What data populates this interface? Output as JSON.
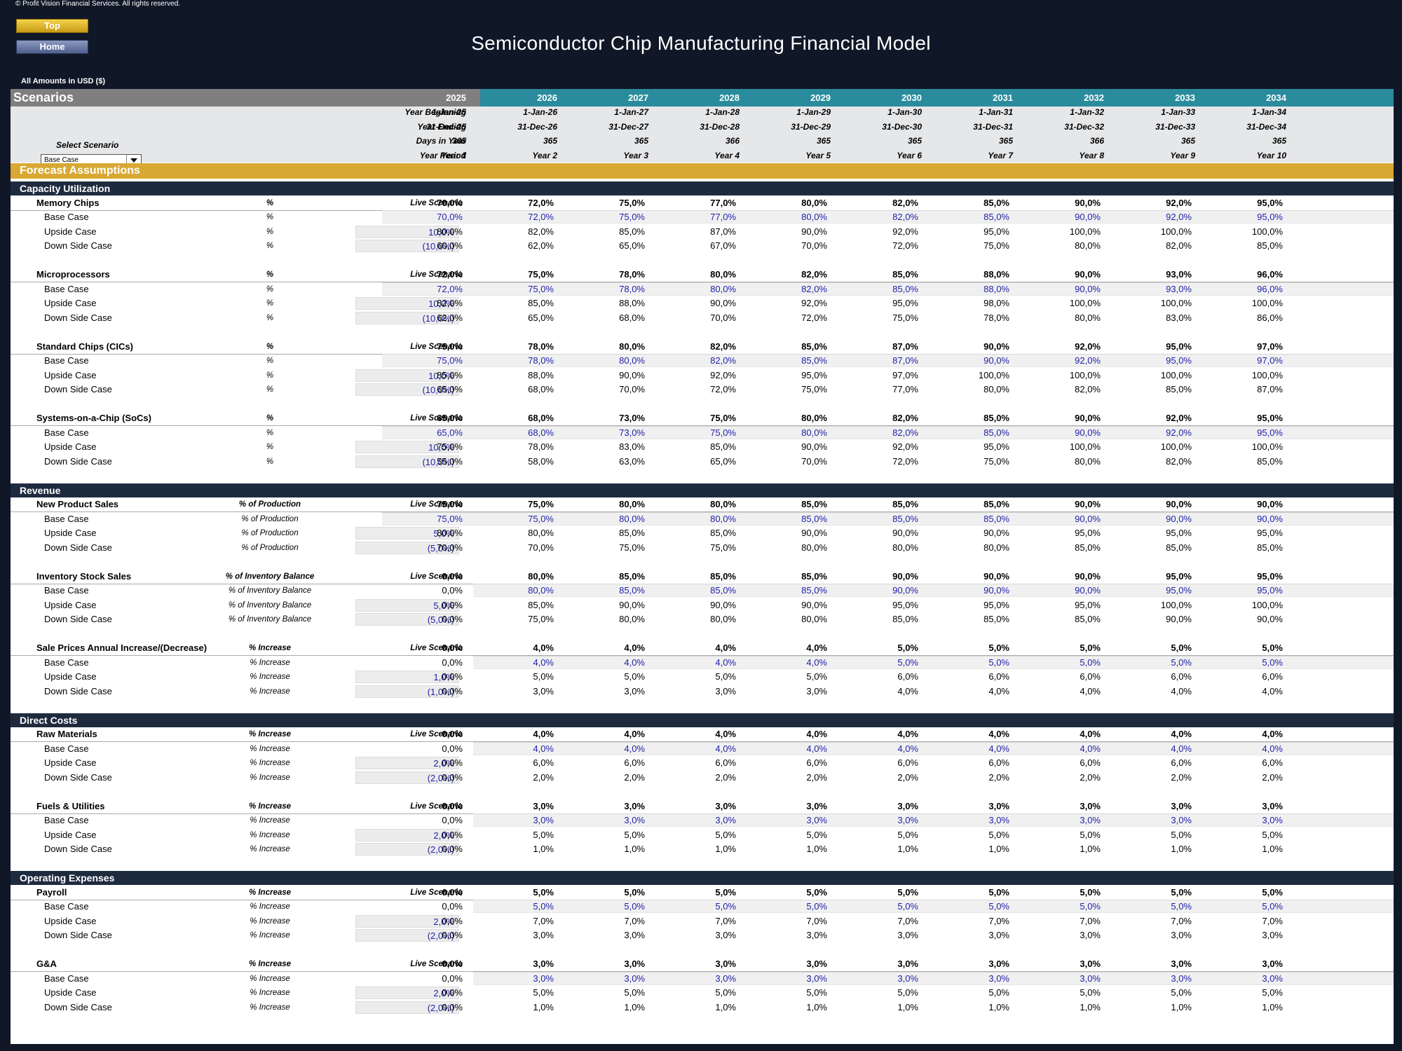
{
  "copyright": "© Profit Vision Financial Services. All rights reserved.",
  "nav": {
    "top": "Top",
    "home": "Home"
  },
  "title": "Semiconductor Chip Manufacturing Financial Model",
  "amounts_label": "All Amounts in  USD ($)",
  "header": {
    "label": "Scenarios",
    "years": [
      "2025",
      "2026",
      "2027",
      "2028",
      "2029",
      "2030",
      "2031",
      "2032",
      "2033",
      "2034"
    ]
  },
  "info": {
    "select_label": "Select Scenario",
    "select_value": "Base Case",
    "rows": [
      {
        "label": "Year Beginning",
        "values": [
          "1-Jan-25",
          "1-Jan-26",
          "1-Jan-27",
          "1-Jan-28",
          "1-Jan-29",
          "1-Jan-30",
          "1-Jan-31",
          "1-Jan-32",
          "1-Jan-33",
          "1-Jan-34"
        ]
      },
      {
        "label": "Year Ending",
        "values": [
          "31-Dec-25",
          "31-Dec-26",
          "31-Dec-27",
          "31-Dec-28",
          "31-Dec-29",
          "31-Dec-30",
          "31-Dec-31",
          "31-Dec-32",
          "31-Dec-33",
          "31-Dec-34"
        ]
      },
      {
        "label": "Days in Year",
        "values": [
          "365",
          "365",
          "365",
          "366",
          "365",
          "365",
          "365",
          "366",
          "365",
          "365"
        ]
      },
      {
        "label": "Year Period",
        "values": [
          "Year 1",
          "Year 2",
          "Year 3",
          "Year 4",
          "Year 5",
          "Year 6",
          "Year 7",
          "Year 8",
          "Year 9",
          "Year 10"
        ]
      }
    ]
  },
  "forecast_label": "Forecast Assumptions",
  "live_label": "Live Scenario",
  "case_labels": {
    "base": "Base Case",
    "up": "Upside Case",
    "down": "Down Side Case"
  },
  "sections": [
    {
      "title": "Capacity Utilization",
      "groups": [
        {
          "name": "Memory Chips",
          "unit": "%",
          "up_adj": "10,0%",
          "down_adj": "(10,0%)",
          "base_start": 0,
          "live": [
            "70,0%",
            "72,0%",
            "75,0%",
            "77,0%",
            "80,0%",
            "82,0%",
            "85,0%",
            "90,0%",
            "92,0%",
            "95,0%"
          ],
          "base": [
            "70,0%",
            "72,0%",
            "75,0%",
            "77,0%",
            "80,0%",
            "82,0%",
            "85,0%",
            "90,0%",
            "92,0%",
            "95,0%"
          ],
          "up": [
            "80,0%",
            "82,0%",
            "85,0%",
            "87,0%",
            "90,0%",
            "92,0%",
            "95,0%",
            "100,0%",
            "100,0%",
            "100,0%"
          ],
          "down": [
            "60,0%",
            "62,0%",
            "65,0%",
            "67,0%",
            "70,0%",
            "72,0%",
            "75,0%",
            "80,0%",
            "82,0%",
            "85,0%"
          ]
        },
        {
          "name": "Microprocessors",
          "unit": "%",
          "up_adj": "10,0%",
          "down_adj": "(10,0%)",
          "base_start": 0,
          "live": [
            "72,0%",
            "75,0%",
            "78,0%",
            "80,0%",
            "82,0%",
            "85,0%",
            "88,0%",
            "90,0%",
            "93,0%",
            "96,0%"
          ],
          "base": [
            "72,0%",
            "75,0%",
            "78,0%",
            "80,0%",
            "82,0%",
            "85,0%",
            "88,0%",
            "90,0%",
            "93,0%",
            "96,0%"
          ],
          "up": [
            "82,0%",
            "85,0%",
            "88,0%",
            "90,0%",
            "92,0%",
            "95,0%",
            "98,0%",
            "100,0%",
            "100,0%",
            "100,0%"
          ],
          "down": [
            "62,0%",
            "65,0%",
            "68,0%",
            "70,0%",
            "72,0%",
            "75,0%",
            "78,0%",
            "80,0%",
            "83,0%",
            "86,0%"
          ]
        },
        {
          "name": "Standard Chips (CICs)",
          "unit": "%",
          "up_adj": "10,0%",
          "down_adj": "(10,0%)",
          "base_start": 0,
          "live": [
            "75,0%",
            "78,0%",
            "80,0%",
            "82,0%",
            "85,0%",
            "87,0%",
            "90,0%",
            "92,0%",
            "95,0%",
            "97,0%"
          ],
          "base": [
            "75,0%",
            "78,0%",
            "80,0%",
            "82,0%",
            "85,0%",
            "87,0%",
            "90,0%",
            "92,0%",
            "95,0%",
            "97,0%"
          ],
          "up": [
            "85,0%",
            "88,0%",
            "90,0%",
            "92,0%",
            "95,0%",
            "97,0%",
            "100,0%",
            "100,0%",
            "100,0%",
            "100,0%"
          ],
          "down": [
            "65,0%",
            "68,0%",
            "70,0%",
            "72,0%",
            "75,0%",
            "77,0%",
            "80,0%",
            "82,0%",
            "85,0%",
            "87,0%"
          ]
        },
        {
          "name": "Systems-on-a-Chip (SoCs)",
          "unit": "%",
          "up_adj": "10,0%",
          "down_adj": "(10,0%)",
          "base_start": 0,
          "live": [
            "65,0%",
            "68,0%",
            "73,0%",
            "75,0%",
            "80,0%",
            "82,0%",
            "85,0%",
            "90,0%",
            "92,0%",
            "95,0%"
          ],
          "base": [
            "65,0%",
            "68,0%",
            "73,0%",
            "75,0%",
            "80,0%",
            "82,0%",
            "85,0%",
            "90,0%",
            "92,0%",
            "95,0%"
          ],
          "up": [
            "75,0%",
            "78,0%",
            "83,0%",
            "85,0%",
            "90,0%",
            "92,0%",
            "95,0%",
            "100,0%",
            "100,0%",
            "100,0%"
          ],
          "down": [
            "55,0%",
            "58,0%",
            "63,0%",
            "65,0%",
            "70,0%",
            "72,0%",
            "75,0%",
            "80,0%",
            "82,0%",
            "85,0%"
          ]
        }
      ]
    },
    {
      "title": "Revenue",
      "groups": [
        {
          "name": "New Product Sales",
          "unit": "% of Production",
          "up_adj": "5,0%",
          "down_adj": "(5,0%)",
          "base_start": 0,
          "live": [
            "75,0%",
            "75,0%",
            "80,0%",
            "80,0%",
            "85,0%",
            "85,0%",
            "85,0%",
            "90,0%",
            "90,0%",
            "90,0%"
          ],
          "base": [
            "75,0%",
            "75,0%",
            "80,0%",
            "80,0%",
            "85,0%",
            "85,0%",
            "85,0%",
            "90,0%",
            "90,0%",
            "90,0%"
          ],
          "up": [
            "80,0%",
            "80,0%",
            "85,0%",
            "85,0%",
            "90,0%",
            "90,0%",
            "90,0%",
            "95,0%",
            "95,0%",
            "95,0%"
          ],
          "down": [
            "70,0%",
            "70,0%",
            "75,0%",
            "75,0%",
            "80,0%",
            "80,0%",
            "80,0%",
            "85,0%",
            "85,0%",
            "85,0%"
          ]
        },
        {
          "name": "Inventory Stock Sales",
          "unit": "% of Inventory Balance",
          "up_adj": "5,0%",
          "down_adj": "(5,0%)",
          "base_start": 1,
          "live": [
            "0,0%",
            "80,0%",
            "85,0%",
            "85,0%",
            "85,0%",
            "90,0%",
            "90,0%",
            "90,0%",
            "95,0%",
            "95,0%"
          ],
          "base": [
            "0,0%",
            "80,0%",
            "85,0%",
            "85,0%",
            "85,0%",
            "90,0%",
            "90,0%",
            "90,0%",
            "95,0%",
            "95,0%"
          ],
          "up": [
            "0,0%",
            "85,0%",
            "90,0%",
            "90,0%",
            "90,0%",
            "95,0%",
            "95,0%",
            "95,0%",
            "100,0%",
            "100,0%"
          ],
          "down": [
            "0,0%",
            "75,0%",
            "80,0%",
            "80,0%",
            "80,0%",
            "85,0%",
            "85,0%",
            "85,0%",
            "90,0%",
            "90,0%"
          ]
        },
        {
          "name": "Sale Prices Annual Increase/(Decrease)",
          "unit": "% Increase",
          "up_adj": "1,0%",
          "down_adj": "(1,0%)",
          "base_start": 1,
          "live": [
            "0,0%",
            "4,0%",
            "4,0%",
            "4,0%",
            "4,0%",
            "5,0%",
            "5,0%",
            "5,0%",
            "5,0%",
            "5,0%"
          ],
          "base": [
            "0,0%",
            "4,0%",
            "4,0%",
            "4,0%",
            "4,0%",
            "5,0%",
            "5,0%",
            "5,0%",
            "5,0%",
            "5,0%"
          ],
          "up": [
            "0,0%",
            "5,0%",
            "5,0%",
            "5,0%",
            "5,0%",
            "6,0%",
            "6,0%",
            "6,0%",
            "6,0%",
            "6,0%"
          ],
          "down": [
            "0,0%",
            "3,0%",
            "3,0%",
            "3,0%",
            "3,0%",
            "4,0%",
            "4,0%",
            "4,0%",
            "4,0%",
            "4,0%"
          ]
        }
      ]
    },
    {
      "title": "Direct Costs",
      "groups": [
        {
          "name": "Raw Materials",
          "unit": "% Increase",
          "up_adj": "2,0%",
          "down_adj": "(2,0%)",
          "base_start": 1,
          "live": [
            "0,0%",
            "4,0%",
            "4,0%",
            "4,0%",
            "4,0%",
            "4,0%",
            "4,0%",
            "4,0%",
            "4,0%",
            "4,0%"
          ],
          "base": [
            "0,0%",
            "4,0%",
            "4,0%",
            "4,0%",
            "4,0%",
            "4,0%",
            "4,0%",
            "4,0%",
            "4,0%",
            "4,0%"
          ],
          "up": [
            "0,0%",
            "6,0%",
            "6,0%",
            "6,0%",
            "6,0%",
            "6,0%",
            "6,0%",
            "6,0%",
            "6,0%",
            "6,0%"
          ],
          "down": [
            "0,0%",
            "2,0%",
            "2,0%",
            "2,0%",
            "2,0%",
            "2,0%",
            "2,0%",
            "2,0%",
            "2,0%",
            "2,0%"
          ]
        },
        {
          "name": "Fuels & Utilities",
          "unit": "% Increase",
          "up_adj": "2,0%",
          "down_adj": "(2,0%)",
          "base_start": 1,
          "live": [
            "0,0%",
            "3,0%",
            "3,0%",
            "3,0%",
            "3,0%",
            "3,0%",
            "3,0%",
            "3,0%",
            "3,0%",
            "3,0%"
          ],
          "base": [
            "0,0%",
            "3,0%",
            "3,0%",
            "3,0%",
            "3,0%",
            "3,0%",
            "3,0%",
            "3,0%",
            "3,0%",
            "3,0%"
          ],
          "up": [
            "0,0%",
            "5,0%",
            "5,0%",
            "5,0%",
            "5,0%",
            "5,0%",
            "5,0%",
            "5,0%",
            "5,0%",
            "5,0%"
          ],
          "down": [
            "0,0%",
            "1,0%",
            "1,0%",
            "1,0%",
            "1,0%",
            "1,0%",
            "1,0%",
            "1,0%",
            "1,0%",
            "1,0%"
          ]
        }
      ]
    },
    {
      "title": "Operating Expenses",
      "groups": [
        {
          "name": "Payroll",
          "unit": "% Increase",
          "up_adj": "2,0%",
          "down_adj": "(2,0%)",
          "base_start": 1,
          "live": [
            "0,0%",
            "5,0%",
            "5,0%",
            "5,0%",
            "5,0%",
            "5,0%",
            "5,0%",
            "5,0%",
            "5,0%",
            "5,0%"
          ],
          "base": [
            "0,0%",
            "5,0%",
            "5,0%",
            "5,0%",
            "5,0%",
            "5,0%",
            "5,0%",
            "5,0%",
            "5,0%",
            "5,0%"
          ],
          "up": [
            "0,0%",
            "7,0%",
            "7,0%",
            "7,0%",
            "7,0%",
            "7,0%",
            "7,0%",
            "7,0%",
            "7,0%",
            "7,0%"
          ],
          "down": [
            "0,0%",
            "3,0%",
            "3,0%",
            "3,0%",
            "3,0%",
            "3,0%",
            "3,0%",
            "3,0%",
            "3,0%",
            "3,0%"
          ]
        },
        {
          "name": "G&A",
          "unit": "% Increase",
          "up_adj": "2,0%",
          "down_adj": "(2,0%)",
          "base_start": 1,
          "live": [
            "0,0%",
            "3,0%",
            "3,0%",
            "3,0%",
            "3,0%",
            "3,0%",
            "3,0%",
            "3,0%",
            "3,0%",
            "3,0%"
          ],
          "base": [
            "0,0%",
            "3,0%",
            "3,0%",
            "3,0%",
            "3,0%",
            "3,0%",
            "3,0%",
            "3,0%",
            "3,0%",
            "3,0%"
          ],
          "up": [
            "0,0%",
            "5,0%",
            "5,0%",
            "5,0%",
            "5,0%",
            "5,0%",
            "5,0%",
            "5,0%",
            "5,0%",
            "5,0%"
          ],
          "down": [
            "0,0%",
            "1,0%",
            "1,0%",
            "1,0%",
            "1,0%",
            "1,0%",
            "1,0%",
            "1,0%",
            "1,0%",
            "1,0%"
          ]
        }
      ]
    }
  ]
}
